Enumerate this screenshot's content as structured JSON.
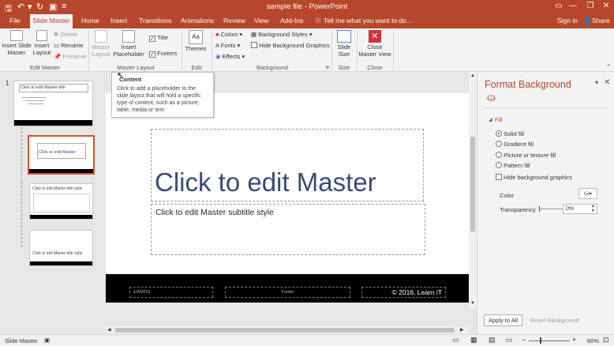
{
  "titlebar": {
    "title": "sample file - PowerPoint",
    "minimize": "—",
    "restore": "❐",
    "close": "✕"
  },
  "tabs": {
    "file": "File",
    "slide_master": "Slide Master",
    "home": "Home",
    "insert": "Insert",
    "transitions": "Transitions",
    "animations": "Animations",
    "review": "Review",
    "view": "View",
    "add_ins": "Add-Ins",
    "tell_me": "Tell me what you want to do...",
    "sign_in": "Sign in",
    "share": "Share"
  },
  "ribbon": {
    "insert_slide_master": "Insert Slide Master",
    "insert_layout": "Insert Layout",
    "delete": "Delete",
    "rename": "Rename",
    "preserve": "Preserve",
    "group_edit_master": "Edit Master",
    "master_layout": "Master Layout",
    "insert_placeholder": "Insert Placeholder",
    "title_chk": "Title",
    "footers_chk": "Footers",
    "group_master_layout": "Master Layout",
    "themes": "Themes",
    "group_edit_theme": "Edit Theme",
    "colors": "Colors",
    "fonts": "Fonts",
    "effects": "Effects",
    "background_styles": "Background Styles",
    "hide_bg_graphics": "Hide Background Graphics",
    "group_background": "Background",
    "slide_size": "Slide Size",
    "group_size": "Size",
    "close_master_view": "Close Master View",
    "group_close": "Close"
  },
  "tooltip": {
    "title": "Content",
    "body": "Click to add a placeholder to the slide layout that will hold a specific type of content, such as a picture, table, media or text."
  },
  "thumbnails": {
    "number": "1",
    "t0": "Click to edit Master title",
    "t1": "Click to edit Master",
    "t2": "Click to edit Master title style",
    "t3": "Click to edit Master title style"
  },
  "slide": {
    "title": "Click to edit Master",
    "subtitle": "Click to edit Master subtitle style",
    "date": "1/4/2016",
    "footer": "Footer",
    "copyright": "© 2016, Learn iT"
  },
  "format_pane": {
    "title": "Format Background",
    "section_fill": "Fill",
    "solid_fill": "Solid fill",
    "gradient_fill": "Gradient fill",
    "picture_texture_fill": "Picture or texture fill",
    "pattern_fill": "Pattern fill",
    "hide_bg_graphics": "Hide background graphics",
    "color_label": "Color",
    "transparency_label": "Transparency",
    "transparency_value": "0%",
    "apply_to_all": "Apply to All",
    "reset_background": "Reset Background"
  },
  "statusbar": {
    "mode": "Slide Master",
    "zoom": "60%"
  },
  "colors": {
    "accent": "#b7472a",
    "slide_title": "#3b4a75"
  }
}
